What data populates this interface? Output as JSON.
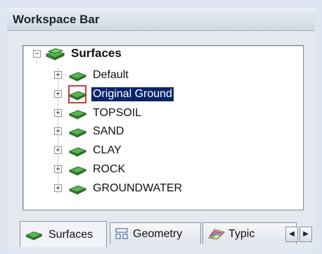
{
  "panel": {
    "title": "Workspace Bar"
  },
  "tree": {
    "root": {
      "label": "Surfaces",
      "expander": "−"
    },
    "items": [
      {
        "label": "Default",
        "expander": "+"
      },
      {
        "label": "Original Ground",
        "expander": "+",
        "selected": true
      },
      {
        "label": "TOPSOIL",
        "expander": "+"
      },
      {
        "label": "SAND",
        "expander": "+"
      },
      {
        "label": "CLAY",
        "expander": "+"
      },
      {
        "label": "ROCK",
        "expander": "+"
      },
      {
        "label": "GROUNDWATER",
        "expander": "+"
      }
    ]
  },
  "tabs": [
    {
      "label": "Surfaces",
      "icon": "surfaces-icon",
      "active": true
    },
    {
      "label": "Geometry",
      "icon": "geometry-icon",
      "active": false
    },
    {
      "label": "Typic",
      "icon": "typical-icon",
      "active": false
    }
  ],
  "tab_scroll": {
    "left": "◀",
    "right": "▶"
  },
  "colors": {
    "selection_bg": "#0a246a",
    "highlight_box": "#d33a3a",
    "surface_green": "#3f9b3a"
  }
}
